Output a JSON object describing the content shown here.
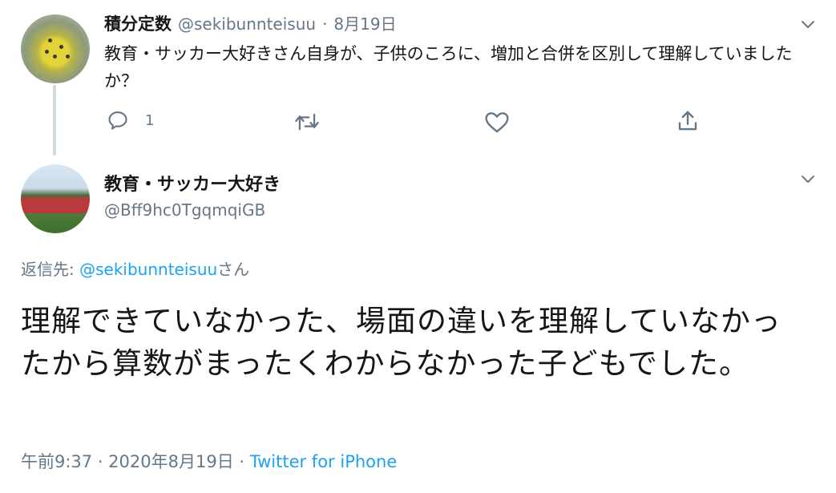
{
  "parent_tweet": {
    "display_name": "積分定数",
    "handle": "@sekibunnteisuu",
    "separator": "·",
    "date": "8月19日",
    "text": "教育・サッカー大好きさん自身が、子供のころに、増加と合併を区別して理解していましたか？",
    "reply_count": "1",
    "icons": [
      "reply-icon",
      "retweet-icon",
      "like-icon",
      "share-icon",
      "chevron-down-icon"
    ]
  },
  "main_tweet": {
    "display_name": "教育・サッカー大好き",
    "handle": "@Bff9hc0TgqmqiGB",
    "replying_to_label": "返信先: ",
    "replying_to_handle": "@sekibunnteisuu",
    "replying_to_suffix": "さん",
    "text": "理解できていなかった、場面の違いを理解していなかったから算数がまったくわからなかった子どもでした。",
    "timestamp": "午前9:37 · 2020年8月19日",
    "meta_separator": " · ",
    "source": "Twitter for iPhone"
  },
  "colors": {
    "accent": "#1da1f2",
    "secondary_text": "#657786",
    "primary_text": "#14171a"
  }
}
